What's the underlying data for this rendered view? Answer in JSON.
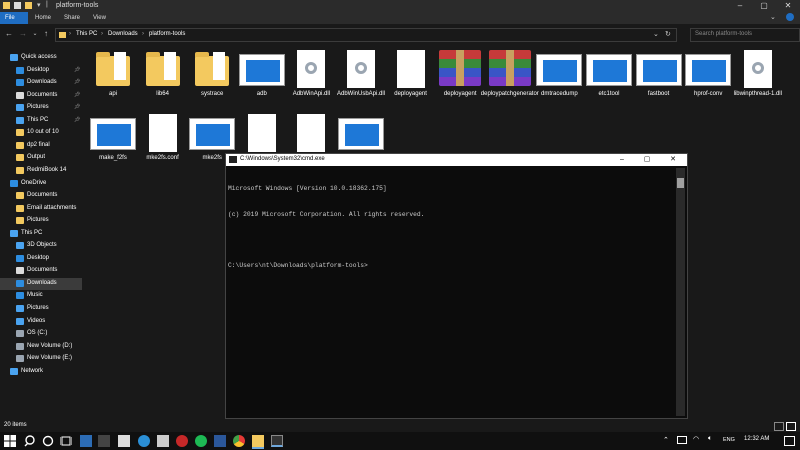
{
  "window": {
    "title": "platform-tools"
  },
  "ribbon": {
    "tabs": [
      "File",
      "Home",
      "Share",
      "View"
    ]
  },
  "address": {
    "crumbs": [
      "This PC",
      "Downloads",
      "platform-tools"
    ],
    "separator": "›",
    "search_placeholder": "Search platform-tools"
  },
  "nav": {
    "items": [
      {
        "label": "Quick access",
        "icon": "star-icon",
        "pinned": false,
        "indent": 0
      },
      {
        "label": "Desktop",
        "icon": "desktop-icon",
        "pinned": true,
        "indent": 1
      },
      {
        "label": "Downloads",
        "icon": "download-icon",
        "pinned": true,
        "indent": 1
      },
      {
        "label": "Documents",
        "icon": "documents-icon",
        "pinned": true,
        "indent": 1
      },
      {
        "label": "Pictures",
        "icon": "pictures-icon",
        "pinned": true,
        "indent": 1
      },
      {
        "label": "This PC",
        "icon": "computer-icon",
        "pinned": true,
        "indent": 1
      },
      {
        "label": "10 out of 10",
        "icon": "folder-icon",
        "pinned": false,
        "indent": 1
      },
      {
        "label": "dp2 final",
        "icon": "folder-icon",
        "pinned": false,
        "indent": 1
      },
      {
        "label": "Output",
        "icon": "folder-icon",
        "pinned": false,
        "indent": 1
      },
      {
        "label": "RedmiBook 14",
        "icon": "folder-icon",
        "pinned": false,
        "indent": 1
      },
      {
        "label": "OneDrive",
        "icon": "cloud-icon",
        "pinned": false,
        "indent": 0
      },
      {
        "label": "Documents",
        "icon": "folder-icon",
        "pinned": false,
        "indent": 1
      },
      {
        "label": "Email attachments",
        "icon": "folder-icon",
        "pinned": false,
        "indent": 1
      },
      {
        "label": "Pictures",
        "icon": "folder-icon",
        "pinned": false,
        "indent": 1
      },
      {
        "label": "This PC",
        "icon": "computer-icon",
        "pinned": false,
        "indent": 0
      },
      {
        "label": "3D Objects",
        "icon": "cube-icon",
        "pinned": false,
        "indent": 1
      },
      {
        "label": "Desktop",
        "icon": "desktop-icon",
        "pinned": false,
        "indent": 1
      },
      {
        "label": "Documents",
        "icon": "documents-icon",
        "pinned": false,
        "indent": 1
      },
      {
        "label": "Downloads",
        "icon": "download-icon",
        "pinned": false,
        "indent": 1,
        "selected": true
      },
      {
        "label": "Music",
        "icon": "music-icon",
        "pinned": false,
        "indent": 1
      },
      {
        "label": "Pictures",
        "icon": "pictures-icon",
        "pinned": false,
        "indent": 1
      },
      {
        "label": "Videos",
        "icon": "videos-icon",
        "pinned": false,
        "indent": 1
      },
      {
        "label": "OS (C:)",
        "icon": "drive-icon",
        "pinned": false,
        "indent": 1
      },
      {
        "label": "New Volume (D:)",
        "icon": "drive-icon",
        "pinned": false,
        "indent": 1
      },
      {
        "label": "New Volume (E:)",
        "icon": "drive-icon",
        "pinned": false,
        "indent": 1
      },
      {
        "label": "Network",
        "icon": "network-icon",
        "pinned": false,
        "indent": 0
      }
    ]
  },
  "files": [
    {
      "name": "api",
      "type": "folder"
    },
    {
      "name": "lib64",
      "type": "folder"
    },
    {
      "name": "systrace",
      "type": "folder"
    },
    {
      "name": "adb",
      "type": "exe"
    },
    {
      "name": "AdbWinApi.dll",
      "type": "dll"
    },
    {
      "name": "AdbWinUsbApi.dll",
      "type": "dll"
    },
    {
      "name": "deployagent",
      "type": "doc"
    },
    {
      "name": "deployagent",
      "type": "rar"
    },
    {
      "name": "deploypatchgenerator",
      "type": "rar"
    },
    {
      "name": "dmtracedump",
      "type": "exe"
    },
    {
      "name": "etc1tool",
      "type": "exe"
    },
    {
      "name": "fastboot",
      "type": "exe"
    },
    {
      "name": "hprof-conv",
      "type": "exe"
    },
    {
      "name": "libwinpthread-1.dll",
      "type": "dll"
    },
    {
      "name": "make_f2fs",
      "type": "exe"
    },
    {
      "name": "mke2fs.conf",
      "type": "doc"
    },
    {
      "name": "mke2fs",
      "type": "exe"
    },
    {
      "name": "",
      "type": "doc"
    },
    {
      "name": "",
      "type": "doc"
    },
    {
      "name": "",
      "type": "exe"
    }
  ],
  "cmd": {
    "title": "C:\\Windows\\System32\\cmd.exe",
    "lines": [
      "Microsoft Windows [Version 10.0.18362.175]",
      "(c) 2019 Microsoft Corporation. All rights reserved.",
      "",
      "C:\\Users\\nt\\Downloads\\platform-tools>"
    ]
  },
  "status": {
    "count": "20 items"
  },
  "taskbar": {
    "lang": "ENG",
    "time": "12:32 AM"
  },
  "colors": {
    "accent": "#1f6dc2",
    "folder": "#f3c95f",
    "background": "#191919"
  }
}
